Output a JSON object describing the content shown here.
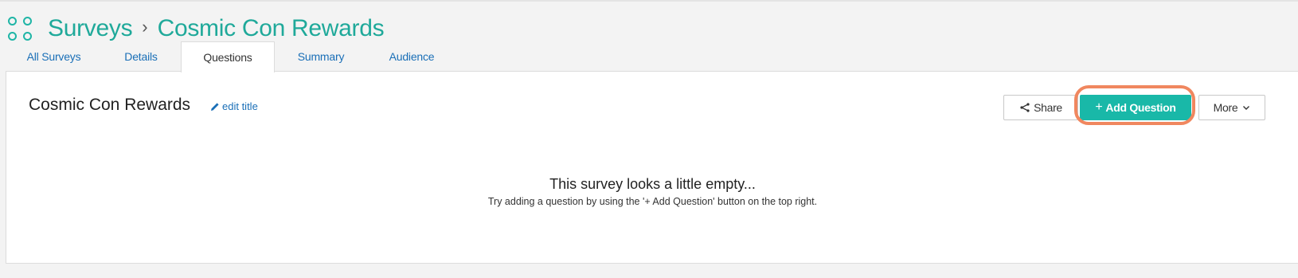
{
  "breadcrumb": {
    "root": "Surveys",
    "separator": "›",
    "current": "Cosmic Con Rewards"
  },
  "tabs": [
    {
      "label": "All Surveys",
      "active": false
    },
    {
      "label": "Details",
      "active": false
    },
    {
      "label": "Questions",
      "active": true
    },
    {
      "label": "Summary",
      "active": false
    },
    {
      "label": "Audience",
      "active": false
    }
  ],
  "survey": {
    "title": "Cosmic Con Rewards",
    "edit_label": "edit title"
  },
  "toolbar": {
    "share_label": "Share",
    "add_question_label": "Add Question",
    "add_question_prefix": "+",
    "more_label": "More"
  },
  "empty_state": {
    "title": "This survey looks a little empty...",
    "hint": "Try adding a question by using the '+ Add Question' button on the top right."
  },
  "colors": {
    "brand_teal": "#19b8a8",
    "link_blue": "#1a6fb7",
    "highlight": "#f0875f"
  },
  "icons": {
    "app": "apps-grid-icon",
    "edit": "pencil-icon",
    "share": "share-icon",
    "more": "chevron-down-icon"
  }
}
